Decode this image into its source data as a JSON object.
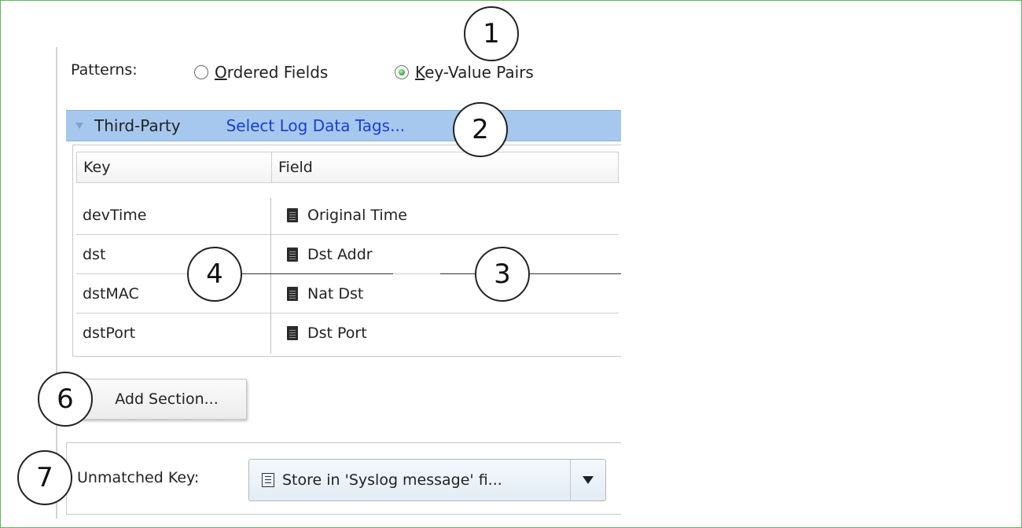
{
  "patterns": {
    "label": "Patterns:",
    "options": [
      {
        "label": "Ordered Fields",
        "checked": false
      },
      {
        "label": "Key-Value Pairs",
        "checked": true
      }
    ]
  },
  "section": {
    "title": "Third-Party",
    "tags_link": "Select Log Data Tags..."
  },
  "table": {
    "columns": [
      "Key",
      "Field"
    ],
    "rows": [
      {
        "key": "devTime",
        "field": "Original Time",
        "icon": "document-icon"
      },
      {
        "key": "dst",
        "field": "Dst Addr",
        "icon": "document-icon"
      },
      {
        "key": "dstMAC",
        "field": "Nat Dst",
        "icon": "document-icon"
      },
      {
        "key": "dstPort",
        "field": "Dst Port",
        "icon": "document-icon"
      }
    ]
  },
  "add_section_button": "Add Section...",
  "unmatched": {
    "label": "Unmatched Key:",
    "selected": "Store in 'Syslog message' fi...",
    "icon": "document-list-icon"
  },
  "callouts": [
    "1",
    "2",
    "3",
    "4",
    "6",
    "7"
  ],
  "colors": {
    "frame_border": "#5cb85c",
    "section_header_bg": "#a6c8ee",
    "link": "#1a3fd0"
  }
}
